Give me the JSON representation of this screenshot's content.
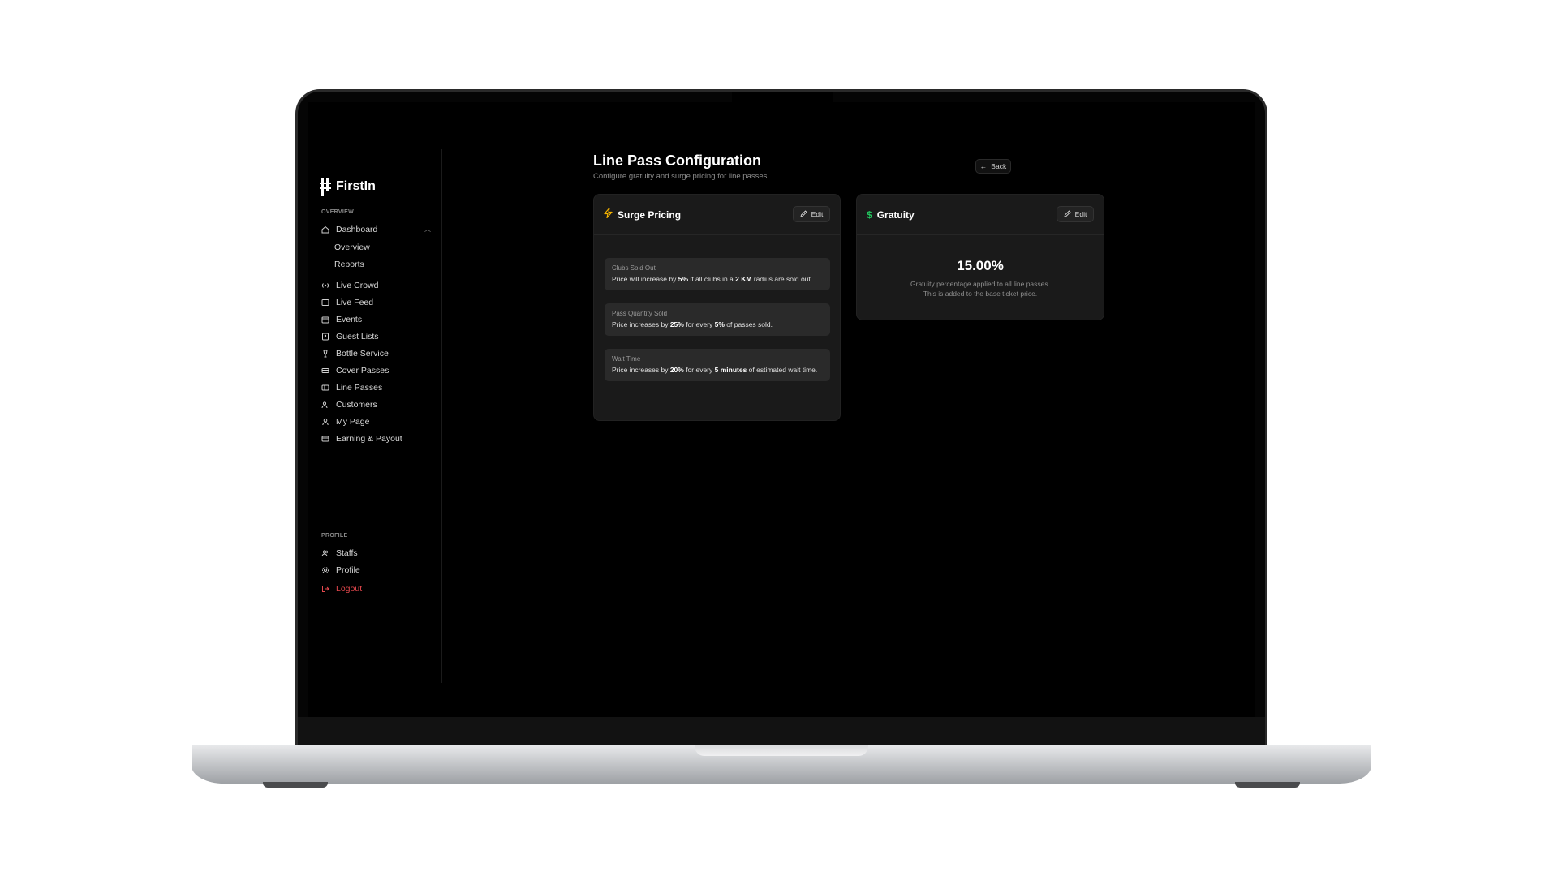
{
  "brand": {
    "name": "FirstIn"
  },
  "sidebar": {
    "overview_label": "OVERVIEW",
    "dashboard": {
      "label": "Dashboard",
      "subitems": [
        "Overview",
        "Reports"
      ]
    },
    "items": [
      {
        "label": "Live Crowd",
        "icon": "broadcast-icon"
      },
      {
        "label": "Live Feed",
        "icon": "feed-icon"
      },
      {
        "label": "Events",
        "icon": "calendar-icon"
      },
      {
        "label": "Guest Lists",
        "icon": "guest-list-icon"
      },
      {
        "label": "Bottle Service",
        "icon": "wine-glass-icon"
      },
      {
        "label": "Cover Passes",
        "icon": "ticket-icon"
      },
      {
        "label": "Line Passes",
        "icon": "pass-icon"
      },
      {
        "label": "Customers",
        "icon": "users-icon"
      },
      {
        "label": "My Page",
        "icon": "user-icon"
      },
      {
        "label": "Earning & Payout",
        "icon": "card-icon"
      }
    ],
    "profile_label": "PROFILE",
    "profile_items": [
      {
        "label": "Staffs",
        "icon": "staff-icon"
      },
      {
        "label": "Profile",
        "icon": "gear-icon"
      }
    ],
    "logout": "Logout"
  },
  "header": {
    "title": "Line Pass Configuration",
    "subtitle": "Configure gratuity and surge pricing for line passes",
    "back": "Back"
  },
  "surge": {
    "title": "Surge Pricing",
    "edit": "Edit",
    "rules": [
      {
        "title": "Clubs Sold Out",
        "pre": "Price will increase by ",
        "b1": "5%",
        "mid": " if all clubs in a ",
        "b2": "2 KM",
        "post": " radius are sold out."
      },
      {
        "title": "Pass Quantity Sold",
        "pre": "Price increases by ",
        "b1": "25%",
        "mid": " for every ",
        "b2": "5%",
        "post": " of passes sold."
      },
      {
        "title": "Wait Time",
        "pre": "Price increases by ",
        "b1": "20%",
        "mid": " for every ",
        "b2": "5 minutes",
        "post": " of estimated wait time."
      }
    ]
  },
  "gratuity": {
    "title": "Gratuity",
    "edit": "Edit",
    "value": "15.00%",
    "description": "Gratuity percentage applied to all line passes. This is added to the base ticket price."
  },
  "colors": {
    "accent_bolt": "#f5b301",
    "accent_dollar": "#22c55e",
    "danger": "#e5484d"
  }
}
